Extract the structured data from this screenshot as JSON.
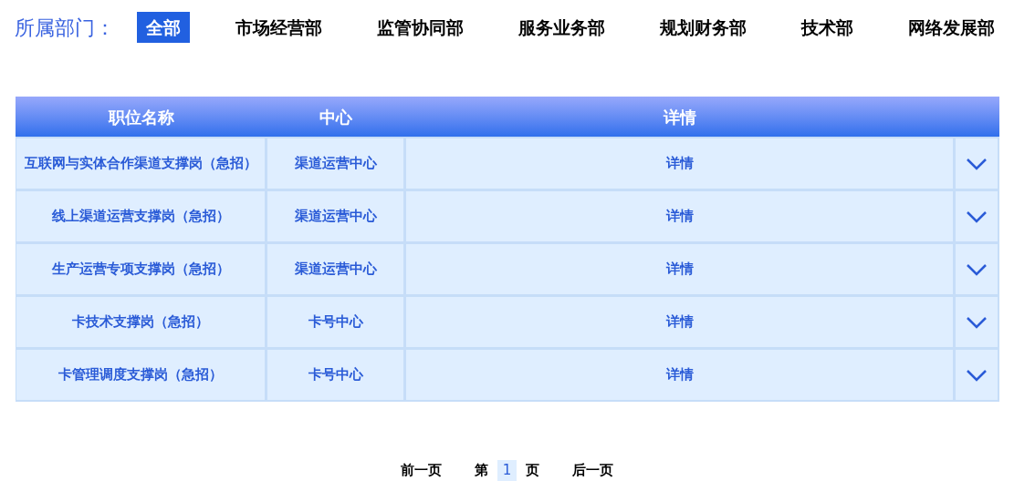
{
  "filter": {
    "label": "所属部门：",
    "options": [
      {
        "label": "全部",
        "selected": true
      },
      {
        "label": "市场经营部",
        "selected": false
      },
      {
        "label": "监管协同部",
        "selected": false
      },
      {
        "label": "服务业务部",
        "selected": false
      },
      {
        "label": "规划财务部",
        "selected": false
      },
      {
        "label": "技术部",
        "selected": false
      },
      {
        "label": "网络发展部",
        "selected": false
      }
    ]
  },
  "table": {
    "columns": [
      "职位名称",
      "中心",
      "详情"
    ],
    "rows": [
      {
        "position": "互联网与实体合作渠道支撑岗（急招）",
        "center": "渠道运营中心",
        "details": "详情",
        "expanded": false
      },
      {
        "position": "线上渠道运营支撑岗（急招）",
        "center": "渠道运营中心",
        "details": "详情",
        "expanded": false
      },
      {
        "position": "生产运营专项支撑岗（急招）",
        "center": "渠道运营中心",
        "details": "详情",
        "expanded": false
      },
      {
        "position": "卡技术支撑岗（急招）",
        "center": "卡号中心",
        "details": "详情",
        "expanded": false
      },
      {
        "position": "卡管理调度支撑岗（急招）",
        "center": "卡号中心",
        "details": "详情",
        "expanded": false
      }
    ]
  },
  "pagination": {
    "previous": "前一页",
    "page_prefix": "第",
    "page": "1",
    "page_suffix": "页",
    "next": "后一页"
  }
}
